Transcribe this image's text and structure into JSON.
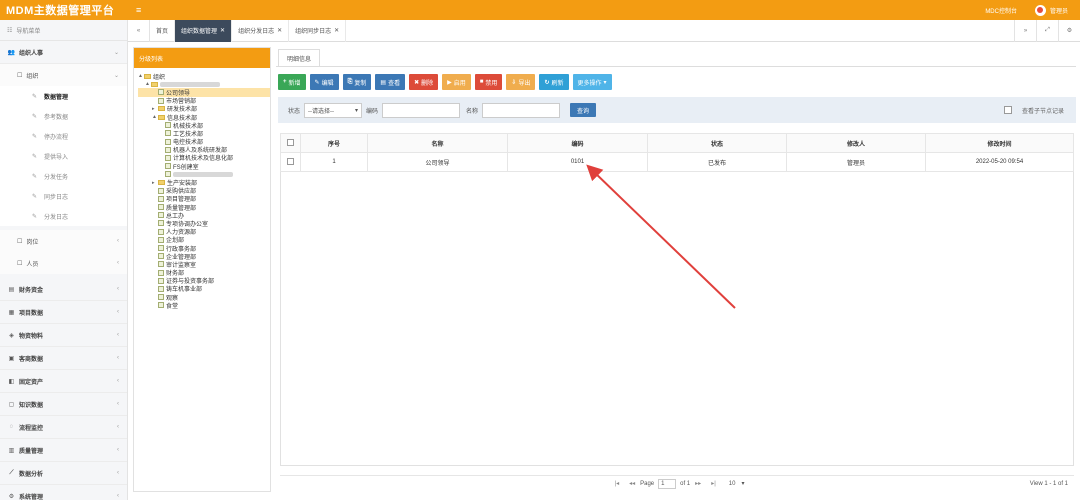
{
  "app": {
    "title": "MDM主数据管理平台",
    "menu_icon": "hamburger-icon",
    "system_label": "MDC控制台",
    "user": "管理员"
  },
  "sidebar": {
    "header": "导航菜单",
    "groups": [
      {
        "label": "组织人事",
        "icon": "users-icon",
        "expanded": true
      },
      {
        "label": "财务资金",
        "icon": "money-icon"
      },
      {
        "label": "项目数据",
        "icon": "project-icon"
      },
      {
        "label": "物资物料",
        "icon": "box-icon"
      },
      {
        "label": "客商数据",
        "icon": "client-icon"
      },
      {
        "label": "固定资产",
        "icon": "asset-icon"
      },
      {
        "label": "知识数据",
        "icon": "book-icon"
      },
      {
        "label": "流程监控",
        "icon": "flow-icon"
      },
      {
        "label": "质量管理",
        "icon": "quality-icon"
      },
      {
        "label": "数据分析",
        "icon": "chart-icon"
      },
      {
        "label": "系统管理",
        "icon": "settings-icon"
      }
    ],
    "org_sub": {
      "label": "组织"
    },
    "org_leaves": [
      "数据管理",
      "参考数据",
      "停办流程",
      "提供导入",
      "分发任务",
      "同步日志",
      "分发日志"
    ],
    "other_subs": [
      "岗位",
      "人员"
    ]
  },
  "tabs": [
    {
      "label": "首页"
    },
    {
      "label": "组织数据管理",
      "active": true
    },
    {
      "label": "组织分发日志"
    },
    {
      "label": "组织同步日志"
    }
  ],
  "tree": {
    "header": "分级列表",
    "nodes": [
      {
        "label": "组织",
        "level": 0,
        "type": "folder",
        "toggle": "▲"
      },
      {
        "label": "",
        "level": 1,
        "type": "folder",
        "toggle": "▲",
        "blurred": true
      },
      {
        "label": "公司领导",
        "level": 2,
        "type": "page",
        "selected": true
      },
      {
        "label": "市场营销部",
        "level": 2,
        "type": "page"
      },
      {
        "label": "研发技术部",
        "level": 2,
        "type": "folder",
        "toggle": "▸"
      },
      {
        "label": "信息技术部",
        "level": 2,
        "type": "folder",
        "toggle": "▲"
      },
      {
        "label": "机械技术部",
        "level": 3,
        "type": "page"
      },
      {
        "label": "工艺技术部",
        "level": 3,
        "type": "page"
      },
      {
        "label": "电控技术部",
        "level": 3,
        "type": "page"
      },
      {
        "label": "机器人及系统研发部",
        "level": 3,
        "type": "page"
      },
      {
        "label": "计算机技术及信息化部",
        "level": 3,
        "type": "page"
      },
      {
        "label": "FS创建室",
        "level": 3,
        "type": "page"
      },
      {
        "label": "",
        "level": 3,
        "type": "page",
        "blurred": true
      },
      {
        "label": "生产安装部",
        "level": 2,
        "type": "folder",
        "toggle": "▸"
      },
      {
        "label": "采购供应部",
        "level": 2,
        "type": "page"
      },
      {
        "label": "项目管理部",
        "level": 2,
        "type": "page"
      },
      {
        "label": "质量管理部",
        "level": 2,
        "type": "page"
      },
      {
        "label": "总工办",
        "level": 2,
        "type": "page"
      },
      {
        "label": "专项协调办公室",
        "level": 2,
        "type": "page"
      },
      {
        "label": "人力资源部",
        "level": 2,
        "type": "page"
      },
      {
        "label": "企划部",
        "level": 2,
        "type": "page"
      },
      {
        "label": "行政事务部",
        "level": 2,
        "type": "page"
      },
      {
        "label": "企业管理部",
        "level": 2,
        "type": "page"
      },
      {
        "label": "审计监察室",
        "level": 2,
        "type": "page"
      },
      {
        "label": "财务部",
        "level": 2,
        "type": "page"
      },
      {
        "label": "证券与投资事务部",
        "level": 2,
        "type": "page"
      },
      {
        "label": "铸车机事业部",
        "level": 2,
        "type": "page"
      },
      {
        "label": "观察",
        "level": 2,
        "type": "page"
      },
      {
        "label": "食堂",
        "level": 2,
        "type": "page"
      }
    ]
  },
  "content": {
    "tab_label": "明细信息",
    "toolbar": [
      {
        "name": "add-button",
        "label": "新增",
        "icon": "+",
        "color": "#3aa757"
      },
      {
        "name": "edit-button",
        "label": "编辑",
        "icon": "✎",
        "color": "#3c78b5"
      },
      {
        "name": "copy-button",
        "label": "复制",
        "icon": "⎘",
        "color": "#3c78b5"
      },
      {
        "name": "view-button",
        "label": "查看",
        "icon": "▤",
        "color": "#3c78b5"
      },
      {
        "name": "delete-button",
        "label": "删除",
        "icon": "✖",
        "color": "#dd4b39"
      },
      {
        "name": "enable-button",
        "label": "启用",
        "icon": "▶",
        "color": "#f0ad4e"
      },
      {
        "name": "disable-button",
        "label": "禁用",
        "icon": "■",
        "color": "#dd4b39"
      },
      {
        "name": "export-button",
        "label": "导出",
        "icon": "⇩",
        "color": "#f0ad4e"
      },
      {
        "name": "refresh-button",
        "label": "刷新",
        "icon": "↻",
        "color": "#2fa0d6"
      },
      {
        "name": "more-button",
        "label": "更多操作",
        "icon": "",
        "color": "#4fb4e8"
      }
    ],
    "search": {
      "status_label": "状态",
      "status_value": "--请选择--",
      "code_label": "编码",
      "name_label": "名称",
      "query_label": "查询",
      "child_label": "查看子节点记录"
    },
    "grid": {
      "columns": [
        "序号",
        "名称",
        "编码",
        "状态",
        "修改人",
        "修改时间"
      ],
      "rows": [
        [
          "1",
          "公司领导",
          "0101",
          "已发布",
          "管理员",
          "2022-05-20 09:54"
        ]
      ]
    },
    "pager": {
      "page_label": "Page",
      "page_value": "1",
      "of_label": "of 1",
      "page_size": "10",
      "view_label": "View 1 - 1 of 1"
    }
  },
  "annotation": {
    "arrow_color": "#e0403c"
  }
}
